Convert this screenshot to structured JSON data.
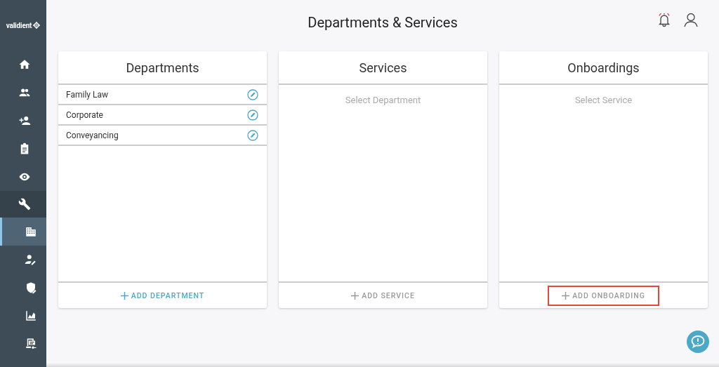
{
  "sidebar": {
    "logo": "validient",
    "items": [
      {
        "selected": false,
        "kind": "top"
      },
      {
        "selected": false,
        "kind": "top"
      },
      {
        "selected": false,
        "kind": "top"
      },
      {
        "selected": false,
        "kind": "top"
      },
      {
        "selected": false,
        "kind": "top"
      },
      {
        "selected": false,
        "kind": "group"
      },
      {
        "selected": true,
        "kind": "sub"
      },
      {
        "selected": false,
        "kind": "sub"
      },
      {
        "selected": false,
        "kind": "sub"
      },
      {
        "selected": false,
        "kind": "sub"
      },
      {
        "selected": false,
        "kind": "sub"
      }
    ]
  },
  "header": {
    "title": "Departments & Services",
    "notifications_alert": true
  },
  "panels": [
    {
      "title": "Departments",
      "items": [
        "Family Law",
        "Corporate",
        "Conveyancing"
      ],
      "add_button": {
        "label": "ADD DEPARTMENT",
        "disabled": false,
        "highlighted": false
      }
    },
    {
      "title": "Services",
      "placeholder": "Select Department",
      "add_button": {
        "label": "ADD SERVICE",
        "disabled": true,
        "highlighted": false
      }
    },
    {
      "title": "Onboardings",
      "placeholder": "Select Service",
      "add_button": {
        "label": "ADD ONBOARDING",
        "disabled": true,
        "highlighted": true
      }
    }
  ]
}
